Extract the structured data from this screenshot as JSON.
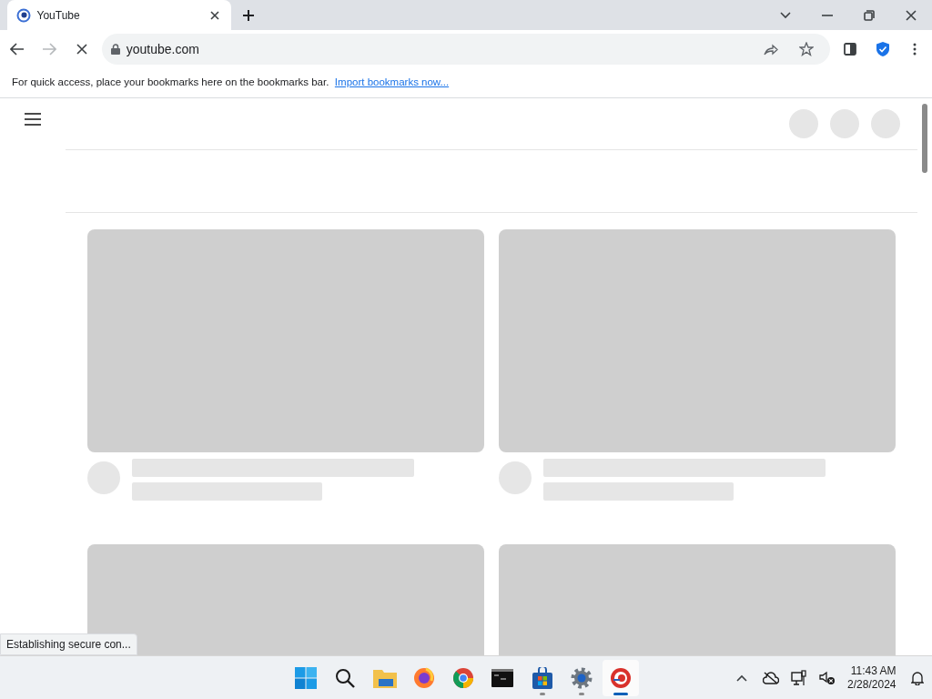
{
  "browser": {
    "tabs": [
      {
        "title": "YouTube",
        "selected": true
      }
    ],
    "address": "youtube.com",
    "loading": true,
    "bookmarks_hint": "For quick access, place your bookmarks here on the bookmarks bar.",
    "bookmarks_link": "Import bookmarks now...",
    "status": "Establishing secure con..."
  },
  "taskbar": {
    "apps": [
      {
        "kind": "start",
        "running": false,
        "active": false
      },
      {
        "kind": "search",
        "running": false,
        "active": false
      },
      {
        "kind": "files",
        "running": false,
        "active": false
      },
      {
        "kind": "firefox",
        "running": false,
        "active": false
      },
      {
        "kind": "chrome",
        "running": false,
        "active": false
      },
      {
        "kind": "terminal",
        "running": false,
        "active": false
      },
      {
        "kind": "store",
        "running": true,
        "active": false
      },
      {
        "kind": "settings",
        "running": true,
        "active": false
      },
      {
        "kind": "browser",
        "running": true,
        "active": true
      }
    ],
    "time": "11:43 AM",
    "date": "2/28/2024"
  }
}
